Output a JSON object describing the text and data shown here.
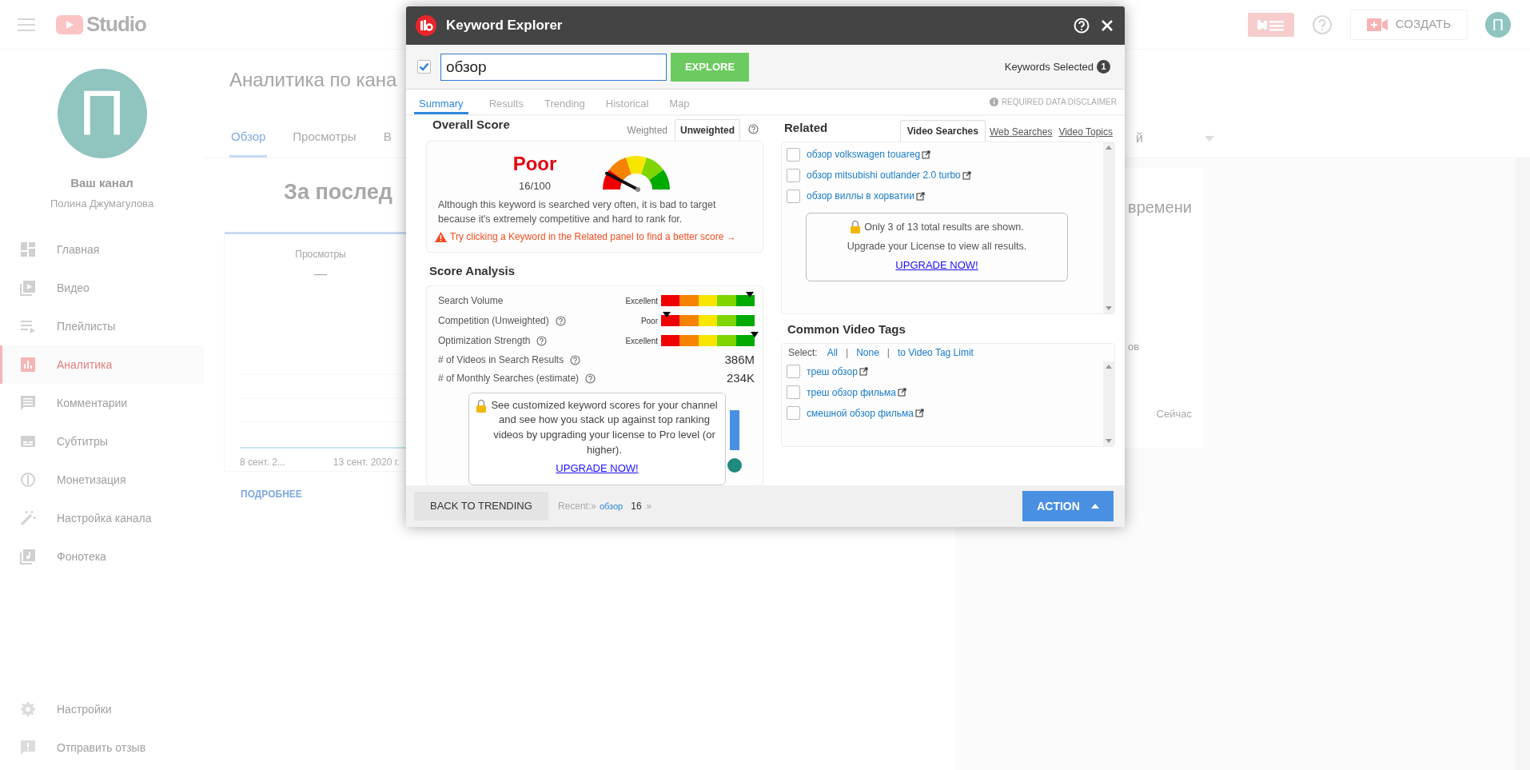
{
  "background": {
    "header": {
      "logo_text": "Studio",
      "create_button": "СОЗДАТЬ",
      "avatar_letter": "П"
    },
    "channel": {
      "avatar_letter": "П",
      "title": "Ваш канал",
      "owner": "Полина Джумагулова"
    },
    "nav": [
      {
        "label": "Главная",
        "selected": false
      },
      {
        "label": "Видео",
        "selected": false
      },
      {
        "label": "Плейлисты",
        "selected": false
      },
      {
        "label": "Аналитика",
        "selected": true
      },
      {
        "label": "Комментарии",
        "selected": false
      },
      {
        "label": "Субтитры",
        "selected": false
      },
      {
        "label": "Монетизация",
        "selected": false
      },
      {
        "label": "Настройка канала",
        "selected": false
      },
      {
        "label": "Фонотека",
        "selected": false
      }
    ],
    "nav_bottom": [
      {
        "label": "Настройки"
      },
      {
        "label": "Отправить отзыв"
      }
    ],
    "page_title": "Аналитика по кана",
    "tabs": [
      {
        "label": "Обзор",
        "selected": true
      },
      {
        "label": "Просмотры",
        "selected": false
      },
      {
        "label": "В",
        "selected": false
      }
    ],
    "period_dropdown": "й",
    "period_heading": "За послед",
    "views_card": {
      "metric": "Просмотры",
      "value": "—",
      "x_labels": [
        "8 сент. 2...",
        "13 сент. 2020 г."
      ],
      "link": "ПОДРОБНЕЕ"
    },
    "realtime_card": {
      "title": "времени",
      "label": "ов",
      "time": "Сейчас"
    }
  },
  "modal": {
    "title": "Keyword Explorer",
    "keyword_checked": true,
    "keyword": "обзор",
    "explore_button": "EXPLORE",
    "keywords_selected_label": "Keywords Selected",
    "keywords_selected_count": "1",
    "tabs": [
      {
        "label": "Summary",
        "selected": true
      },
      {
        "label": "Results",
        "selected": false
      },
      {
        "label": "Trending",
        "selected": false
      },
      {
        "label": "Historical",
        "selected": false
      },
      {
        "label": "Map",
        "selected": false
      }
    ],
    "disclaimer": "REQUIRED DATA DISCLAIMER",
    "overall": {
      "heading": "Overall Score",
      "modes": [
        {
          "label": "Weighted",
          "selected": false
        },
        {
          "label": "Unweighted",
          "selected": true
        }
      ],
      "rating": "Poor",
      "score": "16/100",
      "level": 0.16,
      "description": "Although this keyword is searched very often, it is bad to target because it's extremely competitive and hard to rank for.",
      "tip": "Try clicking a Keyword in the Related panel to find a better score →"
    },
    "analysis": {
      "heading": "Score Analysis",
      "meters": [
        {
          "label": "Search Volume",
          "help": false,
          "rating": "Excellent",
          "level": 0.95
        },
        {
          "label": "Competition (Unweighted)",
          "help": true,
          "rating": "Poor",
          "level": 0.06
        },
        {
          "label": "Optimization Strength",
          "help": true,
          "rating": "Excellent",
          "level": 1
        }
      ],
      "stats": [
        {
          "label": "# of Videos in Search Results",
          "value": "386M"
        },
        {
          "label": "# of Monthly Searches (estimate)",
          "value": "234K"
        }
      ],
      "upsell": {
        "text": "See customized keyword scores for your channel and see how you stack up against top ranking videos by upgrading your license to Pro level (or higher).",
        "link": "UPGRADE NOW!"
      }
    },
    "related": {
      "heading": "Related",
      "tabs": [
        {
          "label": "Video Searches",
          "selected": true
        },
        {
          "label": "Web Searches",
          "selected": false
        },
        {
          "label": "Video Topics",
          "selected": false
        }
      ],
      "items": [
        {
          "label": "обзор volkswagen touareg",
          "checked": false
        },
        {
          "label": "обзор mitsubishi outlander 2.0 turbo",
          "checked": false
        },
        {
          "label": "обзор виллы в хорватии",
          "checked": false
        }
      ],
      "notice": {
        "lines": [
          "Only 3 of 13 total results are shown.",
          "Upgrade your License to view all results."
        ],
        "link": "UPGRADE NOW!"
      }
    },
    "tags": {
      "heading": "Common Video Tags",
      "select_label": "Select:",
      "select_options": [
        {
          "label": "All",
          "kind": "option"
        },
        {
          "label": "|",
          "kind": "separator"
        },
        {
          "label": "None",
          "kind": "option"
        },
        {
          "label": "|",
          "kind": "separator"
        },
        {
          "label": "to Video Tag Limit",
          "kind": "option"
        }
      ],
      "items": [
        {
          "label": "треш обзор",
          "checked": false
        },
        {
          "label": "треш обзор фильма",
          "checked": false
        },
        {
          "label": "смешной обзор фильма",
          "checked": false
        }
      ]
    },
    "footer": {
      "back_button": "BACK TO TRENDING",
      "recent_label": "Recent:»",
      "recent_items": [
        {
          "label": "обзор",
          "kind": "link"
        },
        {
          "label": "16",
          "kind": "count"
        }
      ],
      "recent_more": "»",
      "action_button": "ACTION"
    }
  }
}
